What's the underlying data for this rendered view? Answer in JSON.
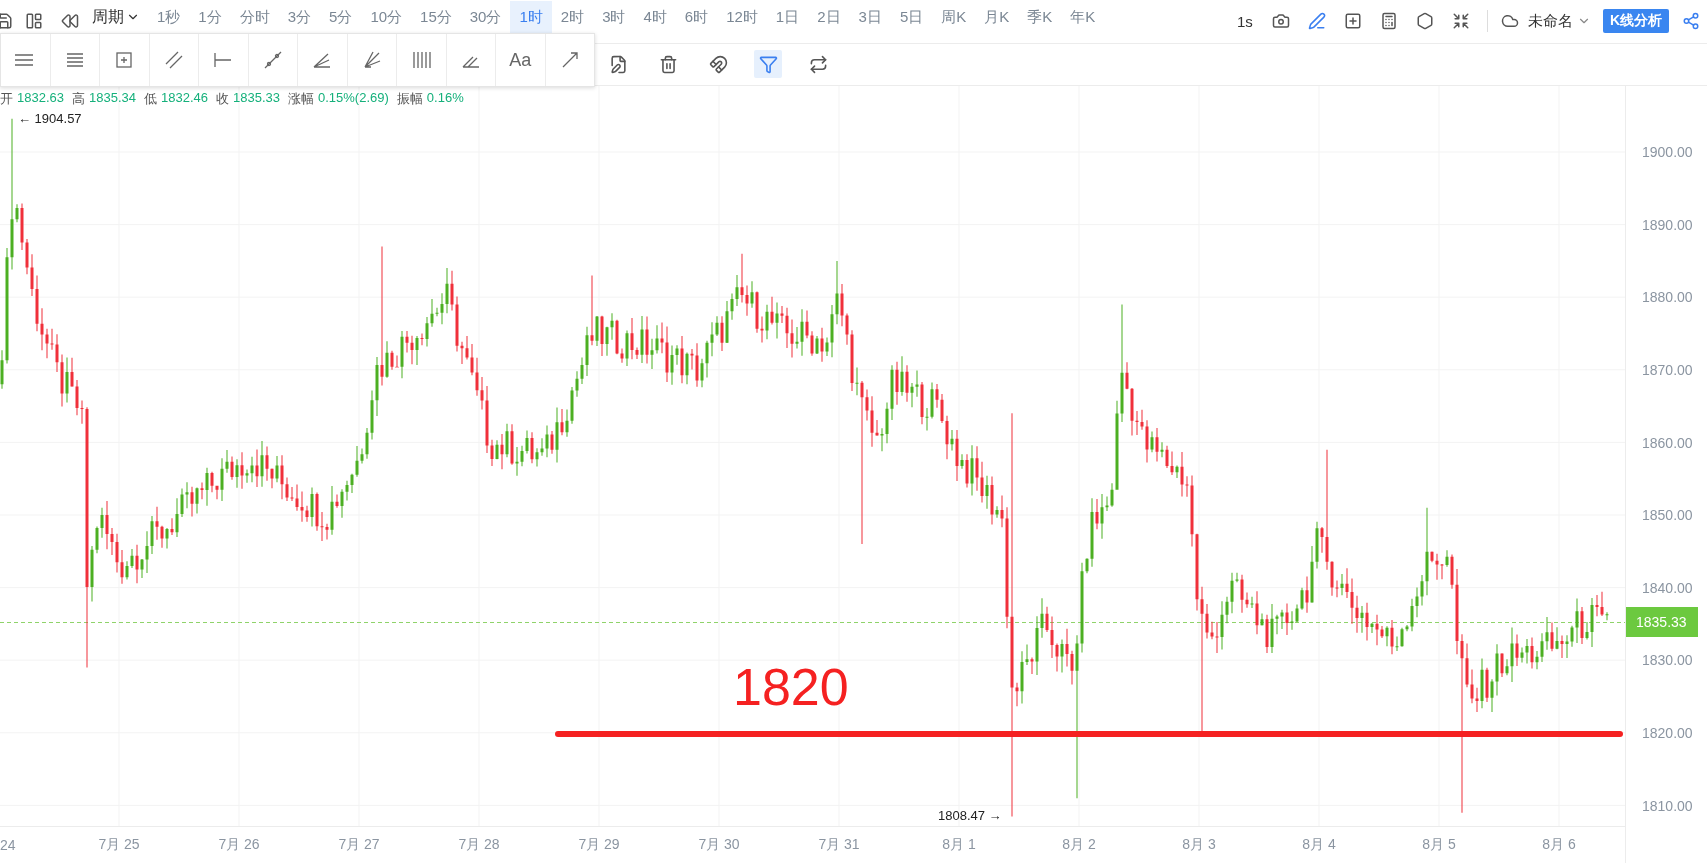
{
  "toolbar": {
    "period_label": "周期",
    "periods": [
      {
        "label": "1秒",
        "selected": false
      },
      {
        "label": "1分",
        "selected": false
      },
      {
        "label": "分时",
        "selected": false
      },
      {
        "label": "3分",
        "selected": false
      },
      {
        "label": "5分",
        "selected": false
      },
      {
        "label": "10分",
        "selected": false
      },
      {
        "label": "15分",
        "selected": false
      },
      {
        "label": "30分",
        "selected": false
      },
      {
        "label": "1时",
        "selected": true
      },
      {
        "label": "2时",
        "selected": false
      },
      {
        "label": "3时",
        "selected": false
      },
      {
        "label": "4时",
        "selected": false
      },
      {
        "label": "6时",
        "selected": false
      },
      {
        "label": "12时",
        "selected": false
      },
      {
        "label": "1日",
        "selected": false
      },
      {
        "label": "2日",
        "selected": false
      },
      {
        "label": "3日",
        "selected": false
      },
      {
        "label": "5日",
        "selected": false
      },
      {
        "label": "周K",
        "selected": false
      },
      {
        "label": "月K",
        "selected": false
      },
      {
        "label": "季K",
        "selected": false
      },
      {
        "label": "年K",
        "selected": false
      }
    ],
    "refresh_label": "1s",
    "document_name": "未命名",
    "analysis_button": "K线分析"
  },
  "drawing_palette": {
    "text_tool": "Aa"
  },
  "tool_actions": [
    {
      "selected": false
    },
    {
      "selected": false
    },
    {
      "selected": false
    },
    {
      "selected": true
    },
    {
      "selected": false
    }
  ],
  "quote": [
    {
      "label": "开",
      "value": "1832.63"
    },
    {
      "label": "高",
      "value": "1835.34"
    },
    {
      "label": "低",
      "value": "1832.46"
    },
    {
      "label": "收",
      "value": "1835.33"
    },
    {
      "label": "涨幅",
      "value": "0.15%(2.69)"
    },
    {
      "label": "振幅",
      "value": "0.16%"
    }
  ],
  "chart": {
    "price_ticks": [
      "1900.00",
      "1890.00",
      "1880.00",
      "1870.00",
      "1860.00",
      "1850.00",
      "1840.00",
      "1830.00",
      "1820.00",
      "1810.00"
    ],
    "date_labels": [
      "24",
      "7月 25",
      "7月 26",
      "7月 27",
      "7月 28",
      "7月 29",
      "7月 30",
      "7月 31",
      "8月 1",
      "8月 2",
      "8月 3",
      "8月 4",
      "8月 5",
      "8月 6"
    ],
    "current_price": "1835.33",
    "high_marker": "← 1904.57",
    "low_marker": "1808.47 →",
    "annotation": "1820"
  }
}
